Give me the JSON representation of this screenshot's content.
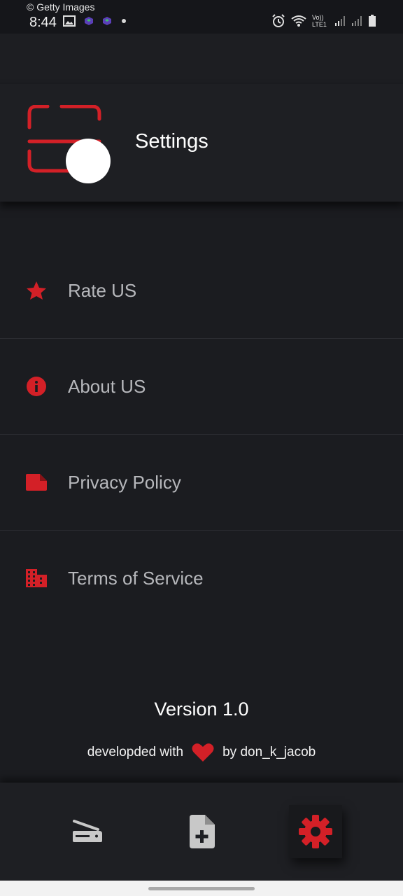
{
  "status_bar": {
    "watermark": "© Getty Images",
    "time": "8:44",
    "network_label": "Vo)) LTE1"
  },
  "header": {
    "title": "Settings"
  },
  "menu": [
    {
      "label": "Rate US",
      "icon": "star-icon"
    },
    {
      "label": "About US",
      "icon": "info-icon"
    },
    {
      "label": "Privacy Policy",
      "icon": "document-icon"
    },
    {
      "label": "Terms of Service",
      "icon": "building-icon"
    }
  ],
  "footer": {
    "version": "Version 1.0",
    "credit_prefix": "developded with",
    "credit_suffix": "by don_k_jacob"
  },
  "bottom_nav": [
    {
      "name": "scanner",
      "icon": "scanner-icon",
      "active": false
    },
    {
      "name": "new-document",
      "icon": "file-add-icon",
      "active": false
    },
    {
      "name": "settings",
      "icon": "gear-icon",
      "active": true
    }
  ],
  "colors": {
    "accent": "#d32027",
    "background": "#1b1c20",
    "menu_text": "#b6b7bb",
    "nav_icon": "#c8c8c8"
  }
}
